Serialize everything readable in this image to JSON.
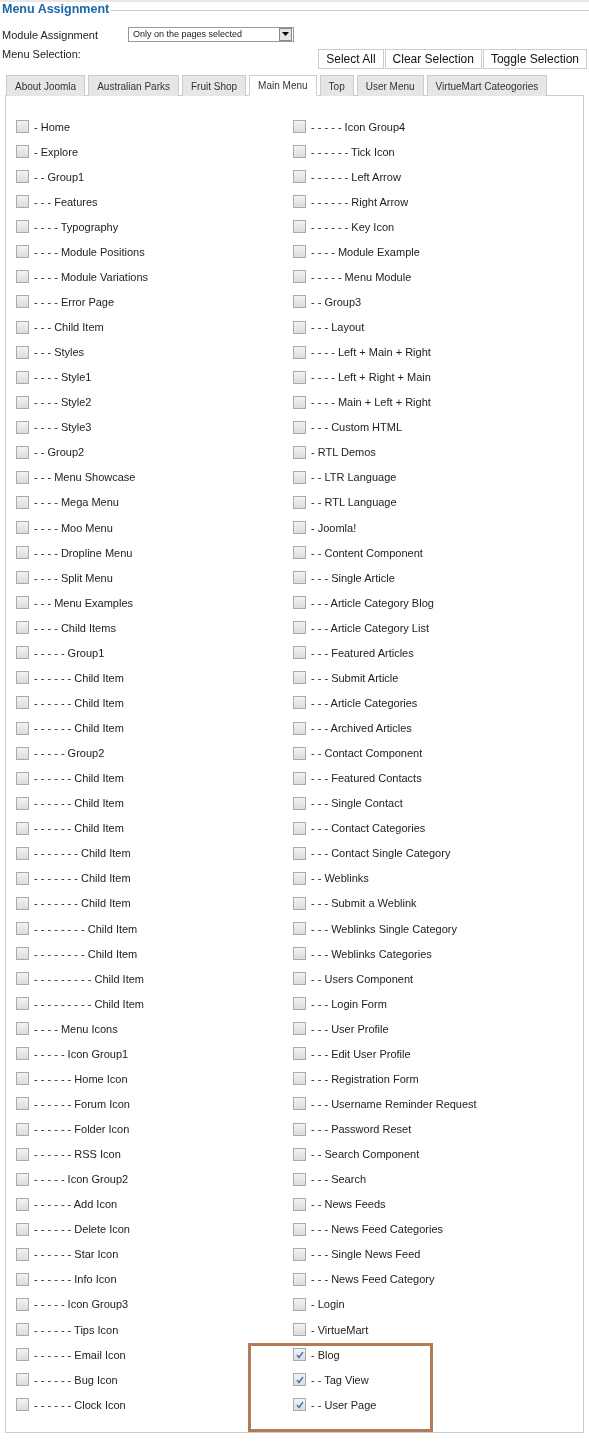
{
  "section_title": "Menu Assignment",
  "module_assignment": {
    "label": "Module Assignment",
    "value": "Only on the pages selected"
  },
  "menu_selection": {
    "label": "Menu Selection:",
    "buttons": [
      "Select All",
      "Clear Selection",
      "Toggle Selection"
    ]
  },
  "tabs": [
    {
      "label": "About Joomla",
      "selected": false
    },
    {
      "label": "Australian Parks",
      "selected": false
    },
    {
      "label": "Fruit Shop",
      "selected": false
    },
    {
      "label": "Main Menu",
      "selected": true
    },
    {
      "label": "Top",
      "selected": false
    },
    {
      "label": "User Menu",
      "selected": false
    },
    {
      "label": "VirtueMart Cateogories",
      "selected": false
    }
  ],
  "columns": [
    {
      "items": [
        {
          "label": "- Home",
          "checked": false,
          "highlighted": false
        },
        {
          "label": "- Explore",
          "checked": false,
          "highlighted": false
        },
        {
          "label": "- - Group1",
          "checked": false,
          "highlighted": false
        },
        {
          "label": "- - - Features",
          "checked": false,
          "highlighted": false
        },
        {
          "label": "- - - - Typography",
          "checked": false,
          "highlighted": false
        },
        {
          "label": "- - - - Module Positions",
          "checked": false,
          "highlighted": false
        },
        {
          "label": "- - - - Module Variations",
          "checked": false,
          "highlighted": false
        },
        {
          "label": "- - - - Error Page",
          "checked": false,
          "highlighted": false
        },
        {
          "label": "- - - Child Item",
          "checked": false,
          "highlighted": false
        },
        {
          "label": "- - - Styles",
          "checked": false,
          "highlighted": false
        },
        {
          "label": "- - - - Style1",
          "checked": false,
          "highlighted": false
        },
        {
          "label": "- - - - Style2",
          "checked": false,
          "highlighted": false
        },
        {
          "label": "- - - - Style3",
          "checked": false,
          "highlighted": false
        },
        {
          "label": "- - Group2",
          "checked": false,
          "highlighted": false
        },
        {
          "label": "- - - Menu Showcase",
          "checked": false,
          "highlighted": false
        },
        {
          "label": "- - - - Mega Menu",
          "checked": false,
          "highlighted": false
        },
        {
          "label": "- - - - Moo Menu",
          "checked": false,
          "highlighted": false
        },
        {
          "label": "- - - - Dropline Menu",
          "checked": false,
          "highlighted": false
        },
        {
          "label": "- - - - Split Menu",
          "checked": false,
          "highlighted": false
        },
        {
          "label": "- - - Menu Examples",
          "checked": false,
          "highlighted": false
        },
        {
          "label": "- - - - Child Items",
          "checked": false,
          "highlighted": false
        },
        {
          "label": "- - - - - Group1",
          "checked": false,
          "highlighted": false
        },
        {
          "label": "- - - - - - Child Item",
          "checked": false,
          "highlighted": false
        },
        {
          "label": "- - - - - - Child Item",
          "checked": false,
          "highlighted": false
        },
        {
          "label": "- - - - - - Child Item",
          "checked": false,
          "highlighted": false
        },
        {
          "label": "- - - - - Group2",
          "checked": false,
          "highlighted": false
        },
        {
          "label": "- - - - - - Child Item",
          "checked": false,
          "highlighted": false
        },
        {
          "label": "- - - - - - Child Item",
          "checked": false,
          "highlighted": false
        },
        {
          "label": "- - - - - - Child Item",
          "checked": false,
          "highlighted": false
        },
        {
          "label": "- - - - - - - Child Item",
          "checked": false,
          "highlighted": false
        },
        {
          "label": "- - - - - - - Child Item",
          "checked": false,
          "highlighted": false
        },
        {
          "label": "- - - - - - - Child Item",
          "checked": false,
          "highlighted": false
        },
        {
          "label": "- - - - - - - - Child Item",
          "checked": false,
          "highlighted": false
        },
        {
          "label": "- - - - - - - - Child Item",
          "checked": false,
          "highlighted": false
        },
        {
          "label": "- - - - - - - - - Child Item",
          "checked": false,
          "highlighted": false
        },
        {
          "label": "- - - - - - - - - Child Item",
          "checked": false,
          "highlighted": false
        },
        {
          "label": "- - - - Menu Icons",
          "checked": false,
          "highlighted": false
        },
        {
          "label": "- - - - - Icon Group1",
          "checked": false,
          "highlighted": false
        },
        {
          "label": "- - - - - - Home Icon",
          "checked": false,
          "highlighted": false
        },
        {
          "label": "- - - - - - Forum Icon",
          "checked": false,
          "highlighted": false
        },
        {
          "label": "- - - - - - Folder Icon",
          "checked": false,
          "highlighted": false
        },
        {
          "label": "- - - - - - RSS Icon",
          "checked": false,
          "highlighted": false
        },
        {
          "label": "- - - - - Icon Group2",
          "checked": false,
          "highlighted": false
        },
        {
          "label": "- - - - - - Add Icon",
          "checked": false,
          "highlighted": false
        },
        {
          "label": "- - - - - - Delete Icon",
          "checked": false,
          "highlighted": false
        },
        {
          "label": "- - - - - - Star Icon",
          "checked": false,
          "highlighted": false
        },
        {
          "label": "- - - - - - Info Icon",
          "checked": false,
          "highlighted": false
        },
        {
          "label": "- - - - - Icon Group3",
          "checked": false,
          "highlighted": false
        },
        {
          "label": "- - - - - - Tips Icon",
          "checked": false,
          "highlighted": false
        },
        {
          "label": "- - - - - - Email Icon",
          "checked": false,
          "highlighted": false
        },
        {
          "label": "- - - - - - Bug Icon",
          "checked": false,
          "highlighted": false
        },
        {
          "label": "- - - - - - Clock Icon",
          "checked": false,
          "highlighted": false
        }
      ]
    },
    {
      "items": [
        {
          "label": "- - - - - Icon Group4",
          "checked": false,
          "highlighted": false
        },
        {
          "label": "- - - - - - Tick Icon",
          "checked": false,
          "highlighted": false
        },
        {
          "label": "- - - - - - Left Arrow",
          "checked": false,
          "highlighted": false
        },
        {
          "label": "- - - - - - Right Arrow",
          "checked": false,
          "highlighted": false
        },
        {
          "label": "- - - - - - Key Icon",
          "checked": false,
          "highlighted": false
        },
        {
          "label": "- - - - Module Example",
          "checked": false,
          "highlighted": false
        },
        {
          "label": "- - - - - Menu Module",
          "checked": false,
          "highlighted": false
        },
        {
          "label": "- - Group3",
          "checked": false,
          "highlighted": false
        },
        {
          "label": "- - - Layout",
          "checked": false,
          "highlighted": false
        },
        {
          "label": "- - - - Left + Main + Right",
          "checked": false,
          "highlighted": false
        },
        {
          "label": "- - - - Left + Right + Main",
          "checked": false,
          "highlighted": false
        },
        {
          "label": "- - - - Main + Left + Right",
          "checked": false,
          "highlighted": false
        },
        {
          "label": "- - - Custom HTML",
          "checked": false,
          "highlighted": false
        },
        {
          "label": "- RTL Demos",
          "checked": false,
          "highlighted": false
        },
        {
          "label": "- - LTR Language",
          "checked": false,
          "highlighted": false
        },
        {
          "label": "- - RTL Language",
          "checked": false,
          "highlighted": false
        },
        {
          "label": "- Joomla!",
          "checked": false,
          "highlighted": false
        },
        {
          "label": "- - Content Component",
          "checked": false,
          "highlighted": false
        },
        {
          "label": "- - - Single Article",
          "checked": false,
          "highlighted": false
        },
        {
          "label": "- - - Article Category Blog",
          "checked": false,
          "highlighted": false
        },
        {
          "label": "- - - Article Category List",
          "checked": false,
          "highlighted": false
        },
        {
          "label": "- - - Featured Articles",
          "checked": false,
          "highlighted": false
        },
        {
          "label": "- - - Submit Article",
          "checked": false,
          "highlighted": false
        },
        {
          "label": "- - - Article Categories",
          "checked": false,
          "highlighted": false
        },
        {
          "label": "- - - Archived Articles",
          "checked": false,
          "highlighted": false
        },
        {
          "label": "- - Contact Component",
          "checked": false,
          "highlighted": false
        },
        {
          "label": "- - - Featured Contacts",
          "checked": false,
          "highlighted": false
        },
        {
          "label": "- - - Single Contact",
          "checked": false,
          "highlighted": false
        },
        {
          "label": "- - - Contact Categories",
          "checked": false,
          "highlighted": false
        },
        {
          "label": "- - - Contact Single Category",
          "checked": false,
          "highlighted": false
        },
        {
          "label": "- - Weblinks",
          "checked": false,
          "highlighted": false
        },
        {
          "label": "- - - Submit a Weblink",
          "checked": false,
          "highlighted": false
        },
        {
          "label": "- - - Weblinks Single Category",
          "checked": false,
          "highlighted": false
        },
        {
          "label": "- - - Weblinks Categories",
          "checked": false,
          "highlighted": false
        },
        {
          "label": "- - Users Component",
          "checked": false,
          "highlighted": false
        },
        {
          "label": "- - - Login Form",
          "checked": false,
          "highlighted": false
        },
        {
          "label": "- - - User Profile",
          "checked": false,
          "highlighted": false
        },
        {
          "label": "- - - Edit User Profile",
          "checked": false,
          "highlighted": false
        },
        {
          "label": "- - - Registration Form",
          "checked": false,
          "highlighted": false
        },
        {
          "label": "- - - Username Reminder Request",
          "checked": false,
          "highlighted": false
        },
        {
          "label": "- - - Password Reset",
          "checked": false,
          "highlighted": false
        },
        {
          "label": "- - Search Component",
          "checked": false,
          "highlighted": false
        },
        {
          "label": "- - - Search",
          "checked": false,
          "highlighted": false
        },
        {
          "label": "- - News Feeds",
          "checked": false,
          "highlighted": false
        },
        {
          "label": "- - - News Feed Categories",
          "checked": false,
          "highlighted": false
        },
        {
          "label": "- - - Single News Feed",
          "checked": false,
          "highlighted": false
        },
        {
          "label": "- - - News Feed Category",
          "checked": false,
          "highlighted": false
        },
        {
          "label": "- Login",
          "checked": false,
          "highlighted": false
        },
        {
          "label": "- VirtueMart",
          "checked": false,
          "highlighted": false
        },
        {
          "label": "- Blog",
          "checked": true,
          "highlighted": true
        },
        {
          "label": "- - Tag View",
          "checked": true,
          "highlighted": true
        },
        {
          "label": "- - User Page",
          "checked": true,
          "highlighted": true
        }
      ]
    }
  ]
}
